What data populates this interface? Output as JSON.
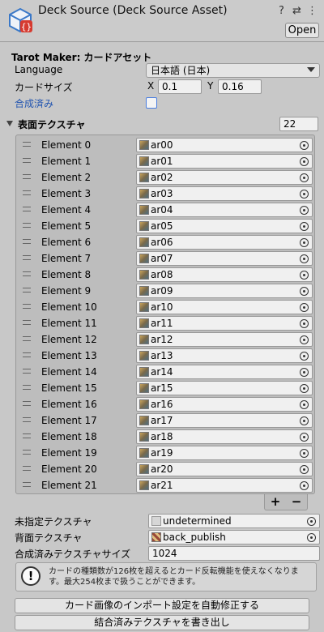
{
  "header": {
    "title": "Deck Source (Deck Source Asset)",
    "open_label": "Open",
    "icons": [
      "help-icon",
      "preset-icon",
      "menu-icon"
    ]
  },
  "inspector": {
    "section_title": "Tarot Maker: カードアセット",
    "language": {
      "label": "Language",
      "value": "日本語 (日本)"
    },
    "card_size": {
      "label": "カードサイズ",
      "x_label": "X",
      "x_value": "0.1",
      "y_label": "Y",
      "y_value": "0.16"
    },
    "composed": {
      "label": "合成済み",
      "checked": false
    },
    "front_textures": {
      "label": "表面テクスチャ",
      "count": "22",
      "elements": [
        {
          "label": "Element 0",
          "value": "ar00"
        },
        {
          "label": "Element 1",
          "value": "ar01"
        },
        {
          "label": "Element 2",
          "value": "ar02"
        },
        {
          "label": "Element 3",
          "value": "ar03"
        },
        {
          "label": "Element 4",
          "value": "ar04"
        },
        {
          "label": "Element 5",
          "value": "ar05"
        },
        {
          "label": "Element 6",
          "value": "ar06"
        },
        {
          "label": "Element 7",
          "value": "ar07"
        },
        {
          "label": "Element 8",
          "value": "ar08"
        },
        {
          "label": "Element 9",
          "value": "ar09"
        },
        {
          "label": "Element 10",
          "value": "ar10"
        },
        {
          "label": "Element 11",
          "value": "ar11"
        },
        {
          "label": "Element 12",
          "value": "ar12"
        },
        {
          "label": "Element 13",
          "value": "ar13"
        },
        {
          "label": "Element 14",
          "value": "ar14"
        },
        {
          "label": "Element 15",
          "value": "ar15"
        },
        {
          "label": "Element 16",
          "value": "ar16"
        },
        {
          "label": "Element 17",
          "value": "ar17"
        },
        {
          "label": "Element 18",
          "value": "ar18"
        },
        {
          "label": "Element 19",
          "value": "ar19"
        },
        {
          "label": "Element 20",
          "value": "ar20"
        },
        {
          "label": "Element 21",
          "value": "ar21"
        }
      ],
      "add_label": "+",
      "remove_label": "−"
    },
    "unassigned_texture": {
      "label": "未指定テクスチャ",
      "value": "undetermined"
    },
    "back_texture": {
      "label": "背面テクスチャ",
      "value": "back_publish"
    },
    "composed_texture_size": {
      "label": "合成済みテクスチャサイズ",
      "value": "1024"
    },
    "help_box": {
      "text": "カードの種類数が126枚を超えるとカード反転機能を使えなくなります。最大254枚まで扱うことができます。",
      "icon": "warning-icon"
    },
    "buttons": {
      "fix_import": "カード画像のインポート設定を自動修正する",
      "write_texture": "結合済みテクスチャを書き出し"
    }
  }
}
